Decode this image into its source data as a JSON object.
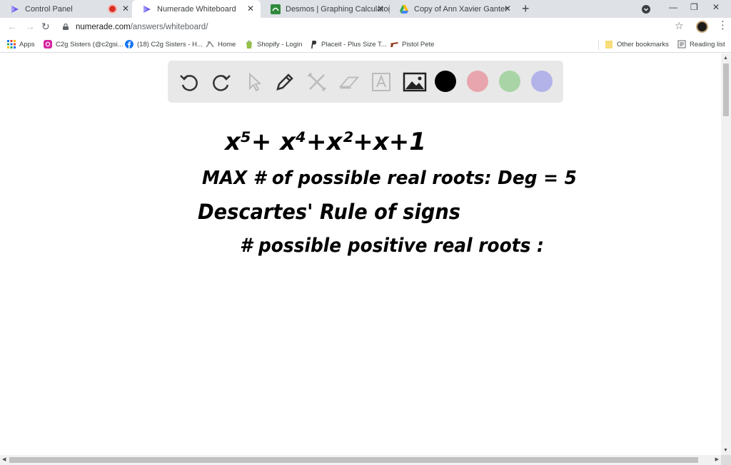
{
  "browser": {
    "tabs": [
      {
        "title": "Control Panel",
        "active": false,
        "favicon": "numerade-icon",
        "recording": true
      },
      {
        "title": "Numerade Whiteboard",
        "active": true,
        "favicon": "numerade-icon"
      },
      {
        "title": "Desmos | Graphing Calculator",
        "active": false,
        "favicon": "desmos-icon"
      },
      {
        "title": "Copy of Ann Xavier Gantert - Alg",
        "active": false,
        "favicon": "google-drive-icon"
      }
    ],
    "url_host": "numerade.com",
    "url_path": "/answers/whiteboard/",
    "bookmarks": [
      {
        "label": "Apps",
        "icon": "apps-grid-icon"
      },
      {
        "label": "C2g Sisters (@c2gsi...",
        "icon": "instagram-icon"
      },
      {
        "label": "(18) C2g Sisters - H...",
        "icon": "facebook-icon"
      },
      {
        "label": "Home",
        "icon": "home-link-icon"
      },
      {
        "label": "Shopify - Login",
        "icon": "shopify-icon"
      },
      {
        "label": "Placeit - Plus Size T...",
        "icon": "placeit-icon"
      },
      {
        "label": "Pistol Pete",
        "icon": "pistol-icon"
      }
    ],
    "other_bookmarks": "Other bookmarks",
    "reading_list": "Reading list"
  },
  "whiteboard": {
    "tools": [
      "undo-icon",
      "redo-icon",
      "select-cursor-icon",
      "pen-icon",
      "tools-icon",
      "eraser-icon",
      "text-icon",
      "image-icon"
    ],
    "colors": [
      "#000000",
      "#e8a5ad",
      "#a9d4a5",
      "#b3b3ea"
    ],
    "handwriting": {
      "line1": "x⁵+ x⁴+x²+x+1",
      "line2": "MAX # of possible real roots: Deg = 5",
      "line3": "Descartes' Rule of signs",
      "line4": "# possible positive real roots :"
    }
  }
}
